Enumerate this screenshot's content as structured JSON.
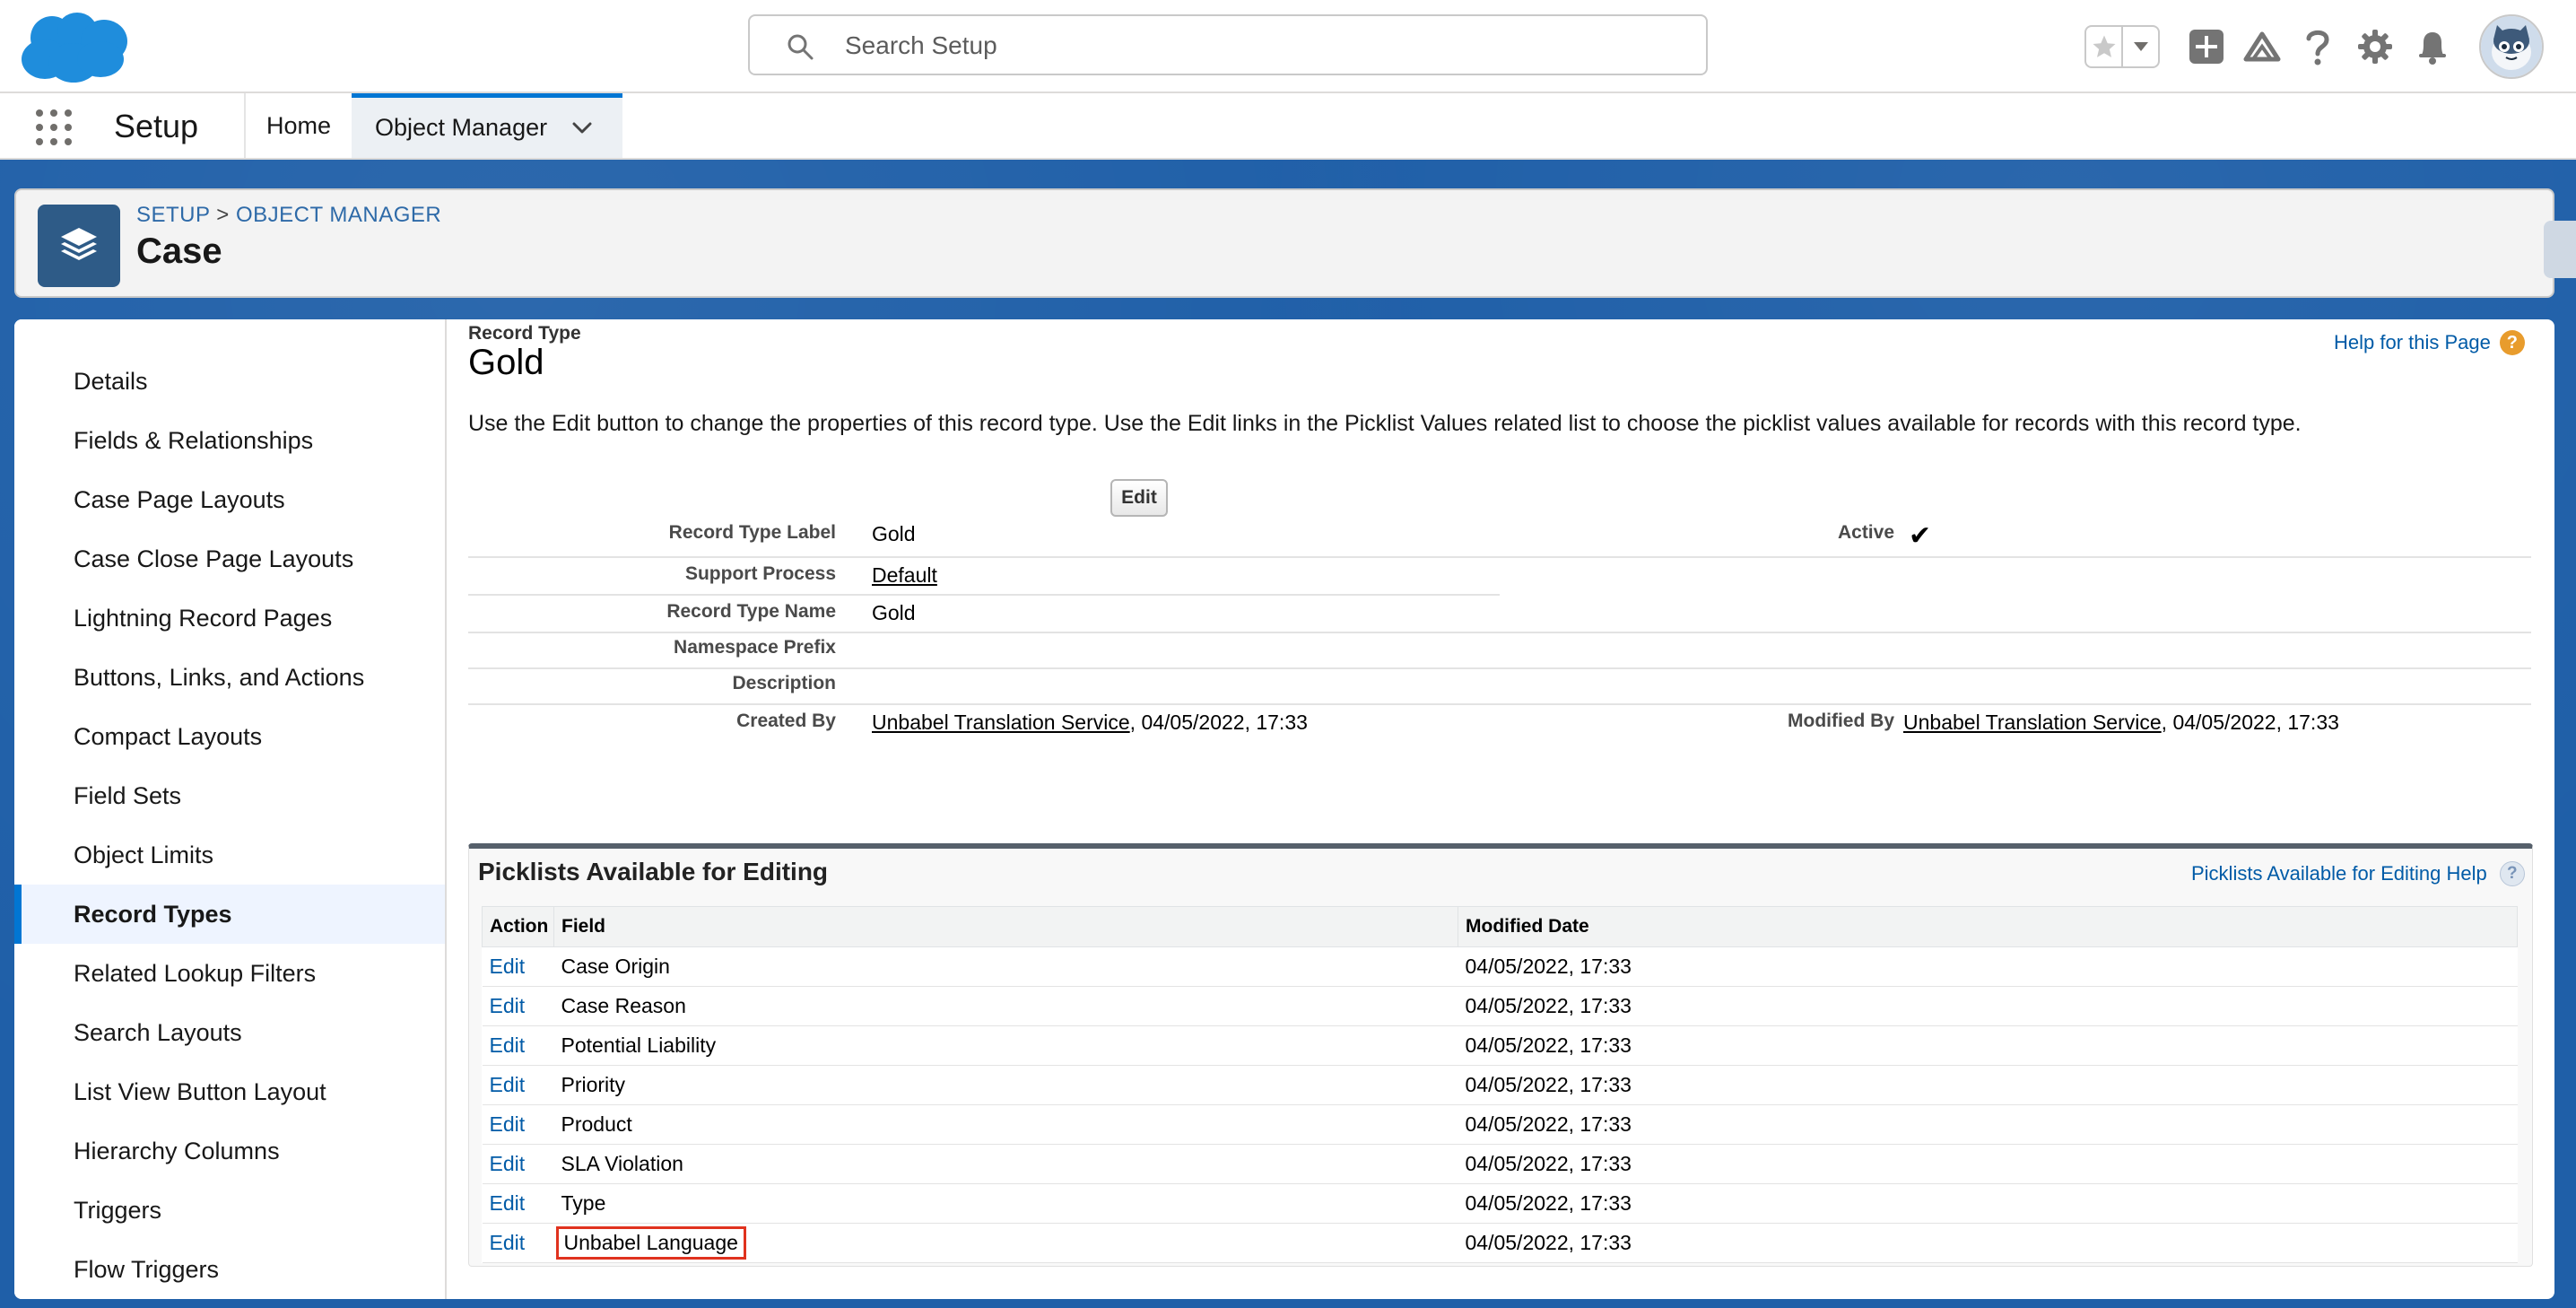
{
  "header": {
    "search_placeholder": "Search Setup",
    "brand_color": "#1f8ddc"
  },
  "nav": {
    "app_name": "Setup",
    "tabs": [
      {
        "label": "Home"
      },
      {
        "label": "Object Manager"
      }
    ]
  },
  "page_header": {
    "breadcrumb_setup": "SETUP",
    "breadcrumb_sep": ">",
    "breadcrumb_object_manager": "OBJECT MANAGER",
    "title": "Case"
  },
  "sidebar": {
    "items": [
      {
        "label": "Details"
      },
      {
        "label": "Fields & Relationships"
      },
      {
        "label": "Case Page Layouts"
      },
      {
        "label": "Case Close Page Layouts"
      },
      {
        "label": "Lightning Record Pages"
      },
      {
        "label": "Buttons, Links, and Actions"
      },
      {
        "label": "Compact Layouts"
      },
      {
        "label": "Field Sets"
      },
      {
        "label": "Object Limits"
      },
      {
        "label": "Record Types"
      },
      {
        "label": "Related Lookup Filters"
      },
      {
        "label": "Search Layouts"
      },
      {
        "label": "List View Button Layout"
      },
      {
        "label": "Hierarchy Columns"
      },
      {
        "label": "Triggers"
      },
      {
        "label": "Flow Triggers"
      }
    ],
    "active": "Record Types"
  },
  "record": {
    "type_label": "Record Type",
    "name": "Gold",
    "help_link": "Help for this Page",
    "help_glyph": "?",
    "intro": "Use the Edit button to change the properties of this record type. Use the Edit links in the Picklist Values related list to choose the picklist values available for records with this record type.",
    "edit_button": "Edit",
    "fields": {
      "record_type_label": {
        "label": "Record Type Label",
        "value": "Gold"
      },
      "active": {
        "label": "Active",
        "value": "✔"
      },
      "support_process": {
        "label": "Support Process",
        "value": "Default"
      },
      "record_type_name": {
        "label": "Record Type Name",
        "value": "Gold"
      },
      "namespace_prefix": {
        "label": "Namespace Prefix",
        "value": ""
      },
      "description": {
        "label": "Description",
        "value": ""
      },
      "created_by": {
        "label": "Created By",
        "user": "Unbabel Translation Service",
        "date": ", 04/05/2022, 17:33"
      },
      "modified_by": {
        "label": "Modified By",
        "user": "Unbabel Translation Service",
        "date": ", 04/05/2022, 17:33"
      }
    }
  },
  "picklists": {
    "title": "Picklists Available for Editing",
    "help_link": "Picklists Available for Editing Help",
    "help_glyph": "?",
    "columns": [
      "Action",
      "Field",
      "Modified Date"
    ],
    "rows": [
      {
        "action": "Edit",
        "field": "Case Origin",
        "modified": "04/05/2022, 17:33"
      },
      {
        "action": "Edit",
        "field": "Case Reason",
        "modified": "04/05/2022, 17:33"
      },
      {
        "action": "Edit",
        "field": "Potential Liability",
        "modified": "04/05/2022, 17:33"
      },
      {
        "action": "Edit",
        "field": "Priority",
        "modified": "04/05/2022, 17:33"
      },
      {
        "action": "Edit",
        "field": "Product",
        "modified": "04/05/2022, 17:33"
      },
      {
        "action": "Edit",
        "field": "SLA Violation",
        "modified": "04/05/2022, 17:33"
      },
      {
        "action": "Edit",
        "field": "Type",
        "modified": "04/05/2022, 17:33"
      },
      {
        "action": "Edit",
        "field": "Unbabel Language",
        "modified": "04/05/2022, 17:33",
        "highlighted": true
      }
    ]
  },
  "icons": [
    "salesforce-cloud-logo",
    "search-icon",
    "favorite-star-icon",
    "favorites-dropdown-icon",
    "add-icon",
    "trailhead-icon",
    "help-icon",
    "gear-icon",
    "bell-icon",
    "avatar",
    "app-launcher-icon",
    "chevron-down-icon",
    "layers-icon",
    "checkmark-icon"
  ]
}
